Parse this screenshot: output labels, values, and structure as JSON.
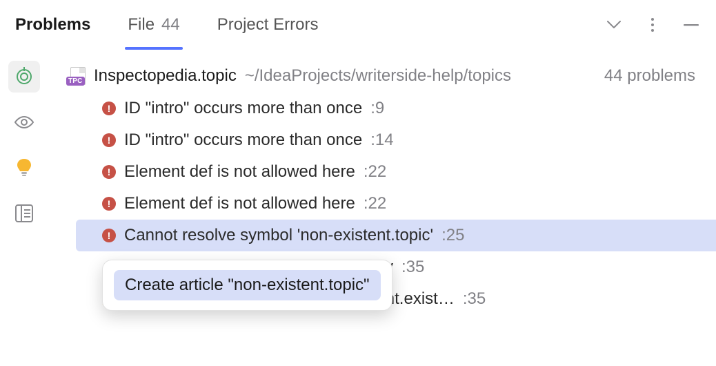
{
  "tabs": {
    "problems": "Problems",
    "file": {
      "label": "File",
      "count": "44"
    },
    "project_errors": "Project Errors"
  },
  "file_header": {
    "name": "Inspectopedia.topic",
    "path": "~/IdeaProjects/writerside-help/topics",
    "count": "44 problems"
  },
  "items": [
    {
      "msg": "ID \"intro\" occurs more than once",
      "loc": ":9"
    },
    {
      "msg": "ID \"intro\" occurs more than once",
      "loc": ":14"
    },
    {
      "msg": "Element def is not allowed here",
      "loc": ":22"
    },
    {
      "msg": "Element def is not allowed here",
      "loc": ":22"
    },
    {
      "msg": "Cannot resolve symbol 'non-existent.topic'",
      "loc": ":25"
    },
    {
      "msg": "The 'alt' attribute is missing or empty",
      "loc": ":35"
    },
    {
      "msg": "Can't reach http://this.address.doesnt.exist…",
      "loc": ":35"
    }
  ],
  "popup": {
    "action": "Create article \"non-existent.topic\""
  },
  "sidebar": {
    "inspect": "inspect-icon",
    "view": "eye-icon",
    "bulb": "bulb-icon",
    "layout": "layout-icon"
  },
  "actions": {
    "collapse": "chevron-down-icon",
    "more": "more-icon",
    "minimize": "minimize-icon"
  }
}
